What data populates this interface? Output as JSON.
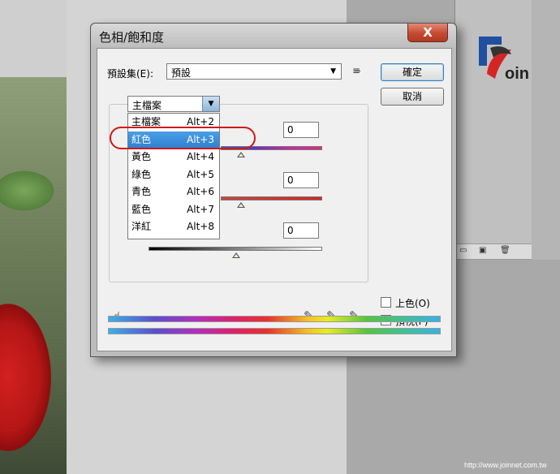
{
  "dialog": {
    "title": "色相/飽和度",
    "close_label": "X",
    "preset_label": "預設集(E):",
    "preset_value": "預設",
    "ok_label": "確定",
    "cancel_label": "取消",
    "channel_value": "主檔案",
    "channel_options": [
      {
        "label": "主檔案",
        "shortcut": "Alt+2"
      },
      {
        "label": "紅色",
        "shortcut": "Alt+3"
      },
      {
        "label": "黃色",
        "shortcut": "Alt+4"
      },
      {
        "label": "綠色",
        "shortcut": "Alt+5"
      },
      {
        "label": "青色",
        "shortcut": "Alt+6"
      },
      {
        "label": "藍色",
        "shortcut": "Alt+7"
      },
      {
        "label": "洋紅",
        "shortcut": "Alt+8"
      }
    ],
    "selected_option_index": 1,
    "hue_value": "0",
    "saturation_value": "0",
    "lightness_value": "0",
    "colorize_label": "上色(O)",
    "preview_label": "預視(P)",
    "colorize_checked": false,
    "preview_checked": true
  },
  "brand": {
    "logo_text": "oin"
  },
  "footer": {
    "url": "http://www.joinnet.com.tw"
  },
  "colors": {
    "selection": "#3399ff",
    "ring": "#d01818",
    "close": "#c54a32"
  }
}
